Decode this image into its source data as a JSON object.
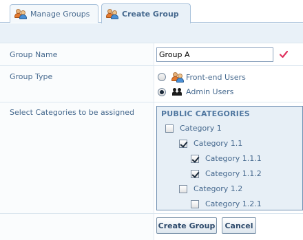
{
  "tabs": {
    "manage_label": "Manage Groups",
    "create_label": "Create Group"
  },
  "form": {
    "group_name_label": "Group Name",
    "group_name_value": "Group A",
    "group_type_label": "Group Type",
    "group_type_options": [
      "Front-end Users",
      "Admin Users"
    ],
    "group_type_selected": "Admin Users",
    "categories_label": "Select Categories to be assigned"
  },
  "categories": {
    "heading": "PUBLIC CATEGORIES",
    "items": [
      {
        "label": "Category 1",
        "checked": false
      },
      {
        "label": "Category 1.1",
        "checked": true
      },
      {
        "label": "Category 1.1.1",
        "checked": true
      },
      {
        "label": "Category 1.1.2",
        "checked": true
      },
      {
        "label": "Category 1.2",
        "checked": false
      },
      {
        "label": "Category 1.2.1",
        "checked": false
      }
    ]
  },
  "buttons": {
    "create_label": "Create Group",
    "cancel_label": "Cancel"
  },
  "icons": {
    "tab_manage": "users-icon",
    "tab_create": "users-icon",
    "name_valid": "check-icon",
    "front_end": "users-icon",
    "admin": "admin-users-icon"
  },
  "colors": {
    "label_text": "#46698e",
    "tab_active_bg": "#e9f1f8",
    "category_box_bg": "#e7eff6",
    "valid_check": "#e0325e"
  }
}
